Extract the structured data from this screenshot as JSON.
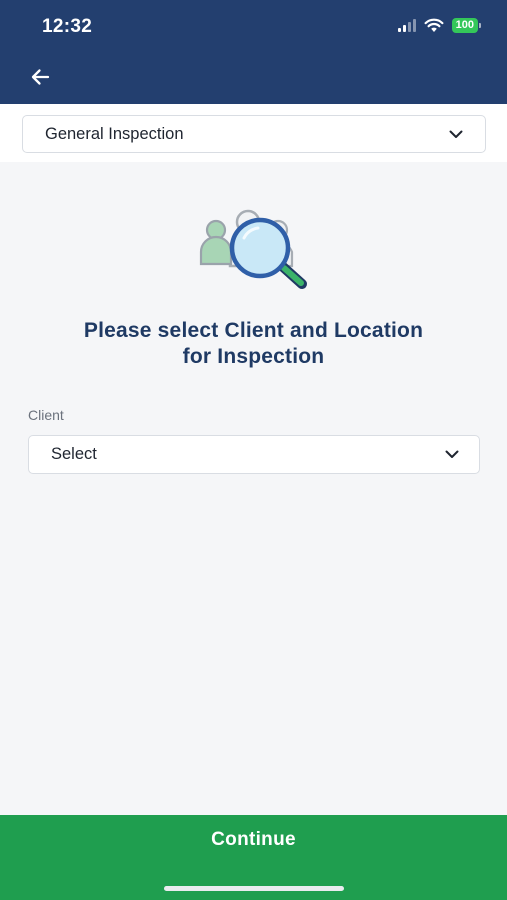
{
  "status_bar": {
    "time": "12:32",
    "battery": "100"
  },
  "header": {
    "back_icon": "arrow-left-icon"
  },
  "inspection_type": {
    "value": "General Inspection",
    "icon": "chevron-down-icon"
  },
  "illustration": {
    "icon": "people-search-icon"
  },
  "prompt": {
    "line1": "Please select Client and Location",
    "line2": "for Inspection"
  },
  "client": {
    "label": "Client",
    "value": "Select",
    "icon": "chevron-down-icon"
  },
  "footer": {
    "continue_label": "Continue"
  },
  "colors": {
    "header": "#233f6f",
    "accent_green": "#1f9e4f",
    "title": "#1f3a64"
  }
}
